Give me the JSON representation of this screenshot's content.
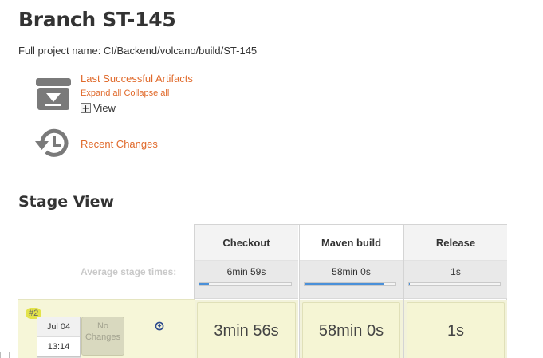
{
  "page": {
    "title": "Branch ST-145",
    "full_name": "Full project name: CI/Backend/volcano/build/ST-145"
  },
  "artifacts": {
    "link": "Last Successful Artifacts",
    "expand_all": "Expand all",
    "collapse_all": "Collapse all",
    "view_toggle_symbol": "+",
    "view": "View"
  },
  "recent_changes": {
    "link": "Recent Changes"
  },
  "stage_view": {
    "heading": "Stage View",
    "avg_label": "Average stage times:",
    "stages": [
      {
        "name": "Checkout",
        "avg": "6min 59s",
        "avg_fraction": 0.1,
        "run": "3min 56s"
      },
      {
        "name": "Maven build",
        "avg": "58min 0s",
        "avg_fraction": 0.88,
        "run": "58min 0s"
      },
      {
        "name": "Release",
        "avg": "1s",
        "avg_fraction": 0.01,
        "run": "1s"
      }
    ],
    "run": {
      "badge": "#2",
      "date": "Jul 04",
      "time": "13:14",
      "changes": "No Changes"
    }
  },
  "colors": {
    "link": "#e0692a",
    "progress_fill": "#4a90d9",
    "run_row": "#f6f6d8",
    "badge": "#e3e34a"
  },
  "icons": [
    "archive-download-icon",
    "history-icon",
    "download-circle-icon"
  ]
}
